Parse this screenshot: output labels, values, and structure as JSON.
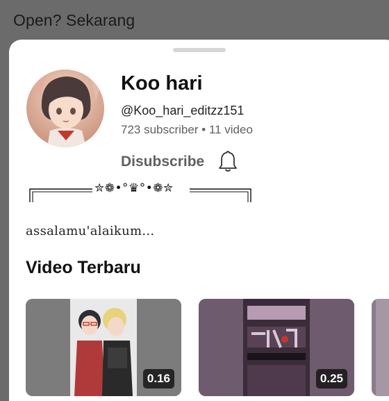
{
  "prompt": {
    "text": "Open? Sekarang"
  },
  "channel": {
    "name": "Koo hari",
    "handle": "@Koo_hari_editzz151",
    "stats": "723 subscriber • 11 video",
    "unsubscribe_label": "Disubscribe",
    "decoration": "✮❁•°♛°•❁✮",
    "description": "assalamu'alaikum..."
  },
  "section": {
    "title": "Video Terbaru"
  },
  "videos": [
    {
      "duration": "0.16"
    },
    {
      "duration": "0.25"
    }
  ],
  "colors": {
    "scrim": "#6b6b6b",
    "sheet": "#ffffff",
    "secondary_text": "#606060"
  },
  "icons": [
    "bell-icon",
    "avatar-image",
    "drag-handle"
  ]
}
